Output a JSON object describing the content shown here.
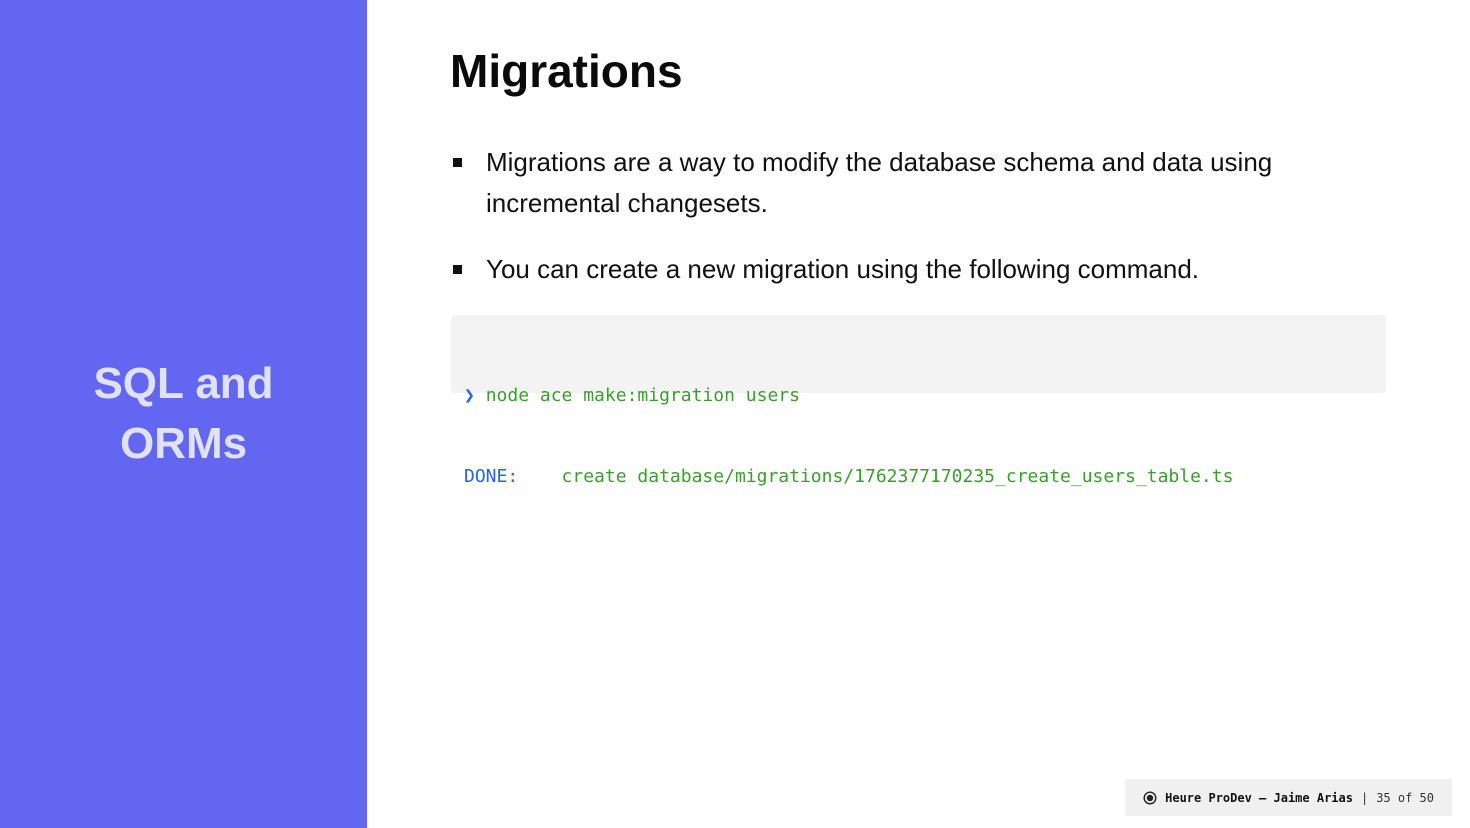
{
  "sidebar": {
    "title_line1": "SQL and",
    "title_line2": "ORMs",
    "background": "#6366f1"
  },
  "main": {
    "title": "Migrations",
    "bullets": [
      {
        "text": "Migrations are a way to modify the database schema and data using incremental changesets."
      },
      {
        "text": "You can create a new migration using the following command."
      }
    ],
    "code": {
      "prompt": "❯",
      "command": "node ace make:migration users",
      "status": "DONE:",
      "action": "create database/migrations/1762377170235_create_users_table.ts"
    }
  },
  "footer": {
    "icon": "record-icon",
    "brand": "Heure ProDev — Jaime Arias",
    "separator": "|",
    "page": "35 of 50"
  }
}
